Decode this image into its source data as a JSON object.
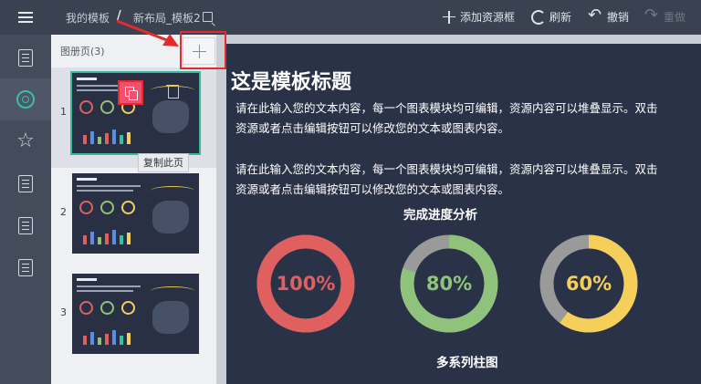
{
  "header": {
    "breadcrumb_root": "我的模板",
    "breadcrumb_sep": "/",
    "breadcrumb_current": "新布局_模板2",
    "tools": {
      "add_resource": "添加资源框",
      "refresh": "刷新",
      "undo": "撤销",
      "redo": "重做"
    }
  },
  "nav": {
    "items": [
      {
        "icon": "document-icon"
      },
      {
        "icon": "target-icon",
        "active": true
      },
      {
        "icon": "star-icon"
      },
      {
        "icon": "list-document-icon"
      },
      {
        "icon": "search-document-icon"
      },
      {
        "icon": "page-document-icon"
      }
    ]
  },
  "pages_panel": {
    "title": "图册页(3)",
    "pages": [
      {
        "number": "1",
        "selected": true
      },
      {
        "number": "2",
        "selected": false
      },
      {
        "number": "3",
        "selected": false
      }
    ],
    "copy_tooltip": "复制此页"
  },
  "canvas": {
    "title": "这是模板标题",
    "paragraph_1": "请在此输入您的文本内容，每一个图表模块均可编辑，资源内容可以堆叠显示。双击资源或者点击编辑按钮可以修改您的文本或图表内容。",
    "paragraph_2": "请在此输入您的文本内容，每一个图表模块均可编辑，资源内容可以堆叠显示。双击资源或者点击编辑按钮可以修改您的文本或图表内容。",
    "progress_title": "完成进度分析",
    "bar_title": "多系列柱图"
  },
  "chart_data": {
    "type": "pie",
    "title": "完成进度分析",
    "series": [
      {
        "label": "100%",
        "value": 100,
        "color": "#e05f5f"
      },
      {
        "label": "80%",
        "value": 80,
        "color": "#8fc27a"
      },
      {
        "label": "60%",
        "value": 60,
        "color": "#f5cf5a"
      }
    ],
    "track_color": "#9a9a9a"
  },
  "colors": {
    "accent": "#36c2a0",
    "annotation": "#e32b2b",
    "copy_button": "#f0506e"
  }
}
